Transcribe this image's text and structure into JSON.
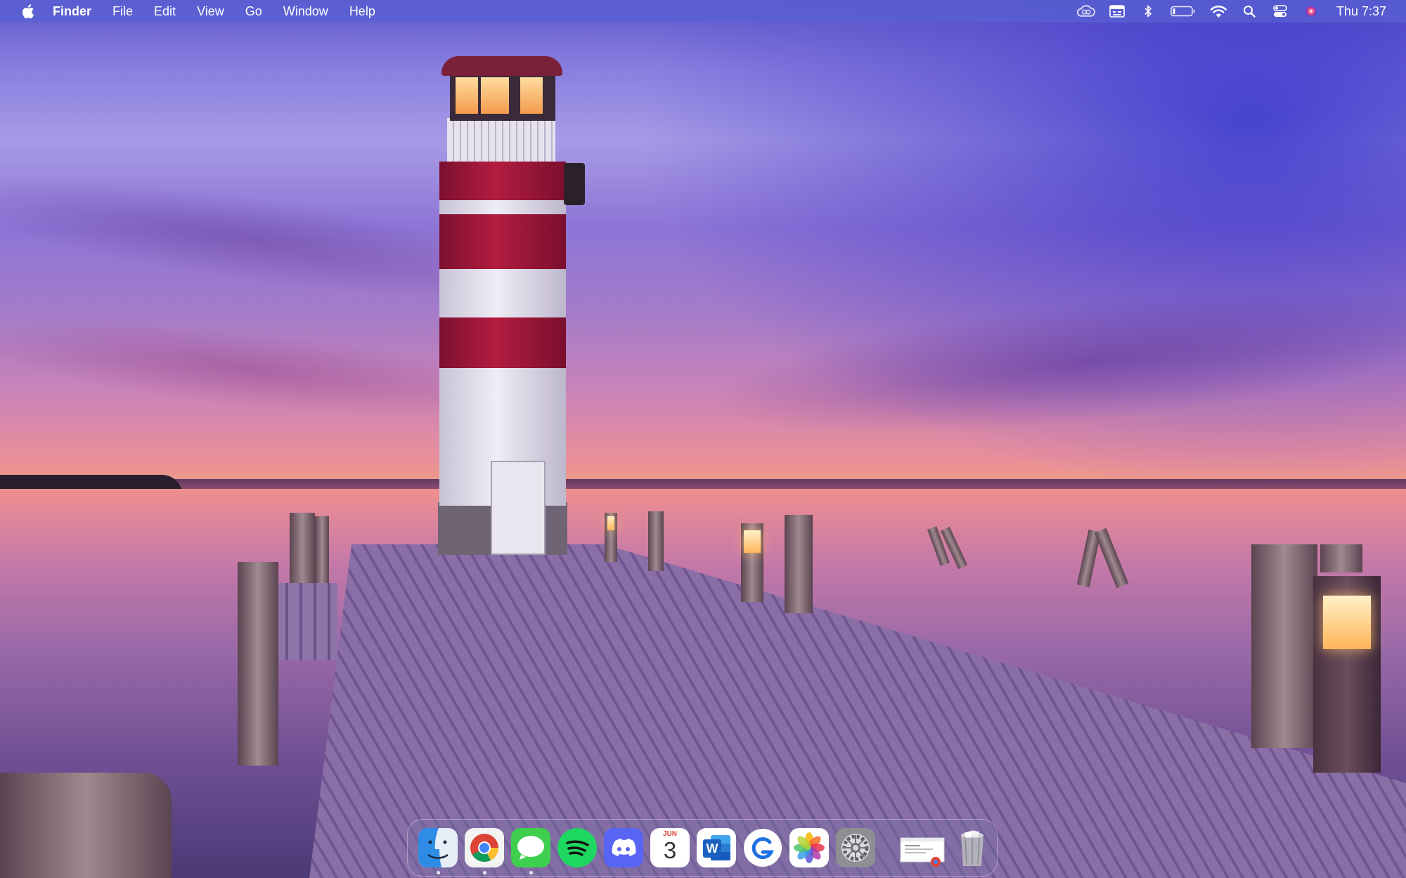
{
  "menubar": {
    "apple_icon": "apple-icon",
    "app_name": "Finder",
    "menus": [
      "File",
      "Edit",
      "View",
      "Go",
      "Window",
      "Help"
    ],
    "status_icons": [
      "creative-cloud-icon",
      "input-source-icon",
      "bluetooth-icon",
      "battery-icon",
      "wifi-icon",
      "spotlight-search-icon",
      "control-center-icon",
      "siri-icon"
    ],
    "clock": "Thu 7:37"
  },
  "dock": {
    "apps": [
      {
        "name": "Finder",
        "icon": "finder-icon",
        "running": true
      },
      {
        "name": "Google Chrome",
        "icon": "chrome-icon",
        "running": true
      },
      {
        "name": "Messages",
        "icon": "messages-icon",
        "running": true
      },
      {
        "name": "Spotify",
        "icon": "spotify-icon",
        "running": false
      },
      {
        "name": "Discord",
        "icon": "discord-icon",
        "running": false
      },
      {
        "name": "Calendar",
        "icon": "calendar-icon",
        "running": false,
        "month": "JUN",
        "day": "3"
      },
      {
        "name": "Microsoft Word",
        "icon": "word-icon",
        "running": false,
        "letter": "W"
      },
      {
        "name": "Grammarly",
        "icon": "grammarly-icon",
        "running": false
      },
      {
        "name": "Photos",
        "icon": "photos-icon",
        "running": false
      },
      {
        "name": "System Preferences",
        "icon": "system-preferences-icon",
        "running": false
      }
    ],
    "minimized": {
      "name": "Chrome window",
      "icon": "chrome-window-thumbnail-icon"
    },
    "trash": {
      "name": "Trash",
      "icon": "trash-icon"
    }
  },
  "wallpaper": {
    "description_icon": "lighthouse-pier-wallpaper"
  }
}
